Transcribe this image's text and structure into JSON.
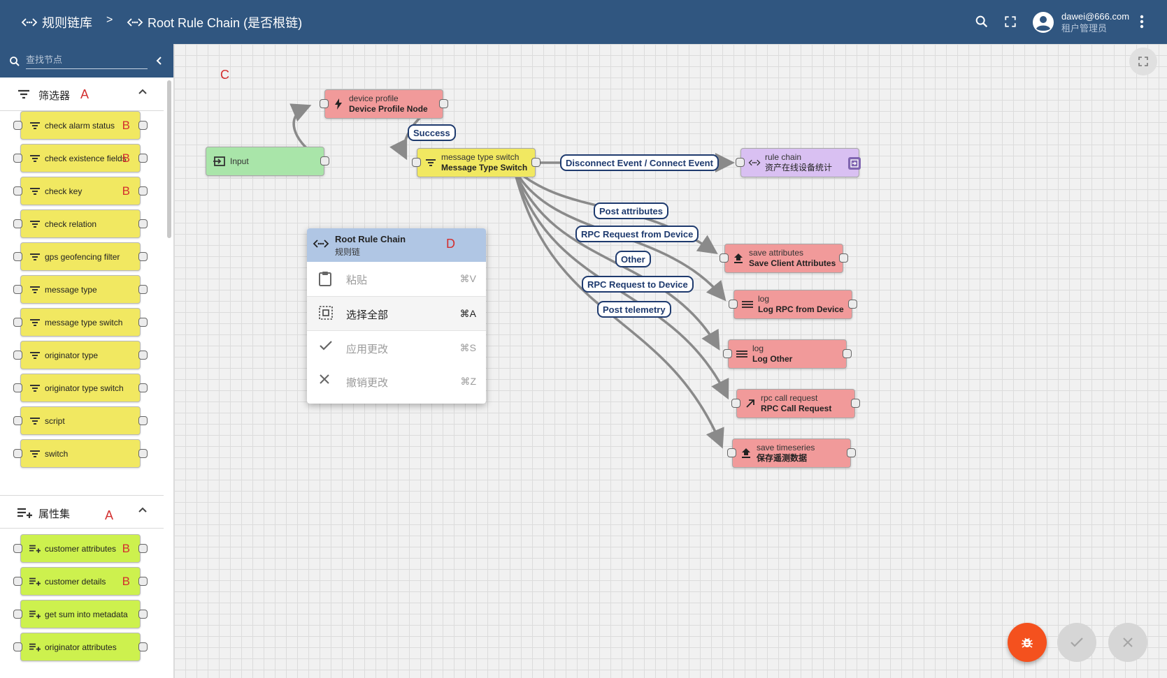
{
  "header": {
    "breadcrumb_root": "规则链库",
    "breadcrumb_separator": ">",
    "breadcrumb_current": "Root Rule Chain (是否根链)",
    "user_email": "dawei@666.com",
    "user_role": "租户管理员",
    "icons": [
      "search-icon",
      "fullscreen-icon",
      "account-circle-icon",
      "more-vert-icon"
    ]
  },
  "sidebar": {
    "search_placeholder": "查找节点",
    "categories": [
      {
        "label": "筛选器",
        "mark": "A",
        "icon": "filter-icon",
        "expanded": true,
        "nodes": [
          {
            "label": "check alarm status",
            "mark": "B"
          },
          {
            "label": "check existence fields",
            "mark": "B"
          },
          {
            "label": "check key",
            "mark": "B"
          },
          {
            "label": "check relation",
            "mark": ""
          },
          {
            "label": "gps geofencing filter",
            "mark": ""
          },
          {
            "label": "message type",
            "mark": ""
          },
          {
            "label": "message type switch",
            "mark": ""
          },
          {
            "label": "originator type",
            "mark": ""
          },
          {
            "label": "originator type switch",
            "mark": ""
          },
          {
            "label": "script",
            "mark": ""
          },
          {
            "label": "switch",
            "mark": ""
          }
        ]
      },
      {
        "label": "属性集",
        "mark": "A",
        "icon": "playlist-add-icon",
        "expanded": true,
        "nodes": [
          {
            "label": "customer attributes",
            "mark": "B"
          },
          {
            "label": "customer details",
            "mark": "B"
          },
          {
            "label": "get sum into metadata",
            "mark": ""
          },
          {
            "label": "originator attributes",
            "mark": ""
          }
        ]
      }
    ]
  },
  "canvas": {
    "mark": "C",
    "nodes": {
      "input": {
        "type": "Input",
        "name": "",
        "color": "#a9e5a9"
      },
      "device_profile": {
        "type": "device profile",
        "name": "Device Profile Node",
        "color": "#f19a9a"
      },
      "msg_switch": {
        "type": "message type switch",
        "name": "Message Type Switch",
        "color": "#f1e861"
      },
      "rule_chain": {
        "type": "rule chain",
        "name": "资产在线设备统计",
        "color": "#d9c0f2"
      },
      "save_attr": {
        "type": "save attributes",
        "name": "Save Client Attributes",
        "color": "#f19a9a"
      },
      "log_rpc": {
        "type": "log",
        "name": "Log RPC from Device",
        "color": "#f19a9a"
      },
      "log_other": {
        "type": "log",
        "name": "Log Other",
        "color": "#f19a9a"
      },
      "rpc_call": {
        "type": "rpc call request",
        "name": "RPC Call Request",
        "color": "#f19a9a"
      },
      "save_ts": {
        "type": "save timeseries",
        "name": "保存遥测数据",
        "color": "#f19a9a"
      }
    },
    "edge_labels": {
      "success": "Success",
      "connect": "Disconnect Event / Connect Event",
      "post_attributes": "Post attributes",
      "rpc_from_device": "RPC Request from Device",
      "other": "Other",
      "rpc_to_device": "RPC Request to Device",
      "post_telemetry": "Post telemetry"
    }
  },
  "context_menu": {
    "title": "Root Rule Chain",
    "subtitle": "规则链",
    "mark": "D",
    "items": [
      {
        "label": "粘贴",
        "shortcut": "⌘V",
        "enabled": false,
        "icon": "clipboard-icon"
      },
      {
        "label": "选择全部",
        "shortcut": "⌘A",
        "enabled": true,
        "icon": "select-all-icon"
      },
      {
        "label": "应用更改",
        "shortcut": "⌘S",
        "enabled": false,
        "icon": "check-icon"
      },
      {
        "label": "撤销更改",
        "shortcut": "⌘Z",
        "enabled": false,
        "icon": "close-icon"
      }
    ]
  },
  "colors": {
    "header_bg": "#305680",
    "filter_node": "#f1e861",
    "enrichment_node": "#cdf14e",
    "action_node": "#f19a9a",
    "input_node": "#a9e5a9",
    "flow_node": "#d9c0f2",
    "debug_fab": "#f4511e",
    "edge_label_border": "#1e3a6e"
  }
}
